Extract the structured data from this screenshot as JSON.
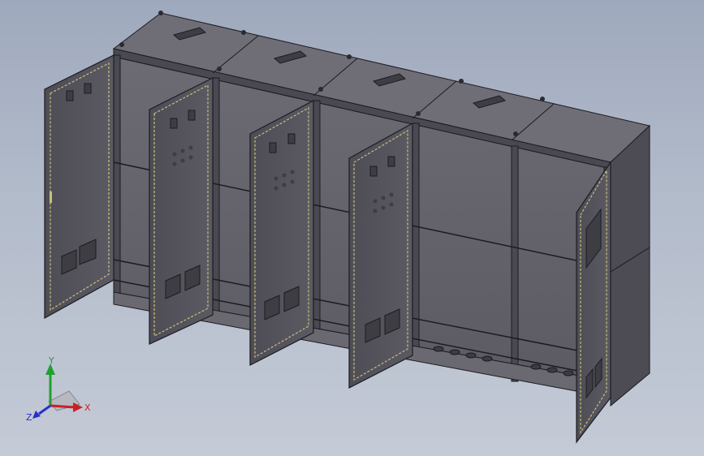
{
  "viewport": {
    "background_top": "#9fa9bd",
    "background_bottom": "#c4cad6",
    "model_color": "#55545c",
    "edge_color": "#1b1b20",
    "hinge_color": "#c9c07a"
  },
  "triad": {
    "x_label": "X",
    "y_label": "Y",
    "z_label": "Z",
    "x_color": "#c8202a",
    "y_color": "#1fa12d",
    "z_color": "#2830c8"
  }
}
